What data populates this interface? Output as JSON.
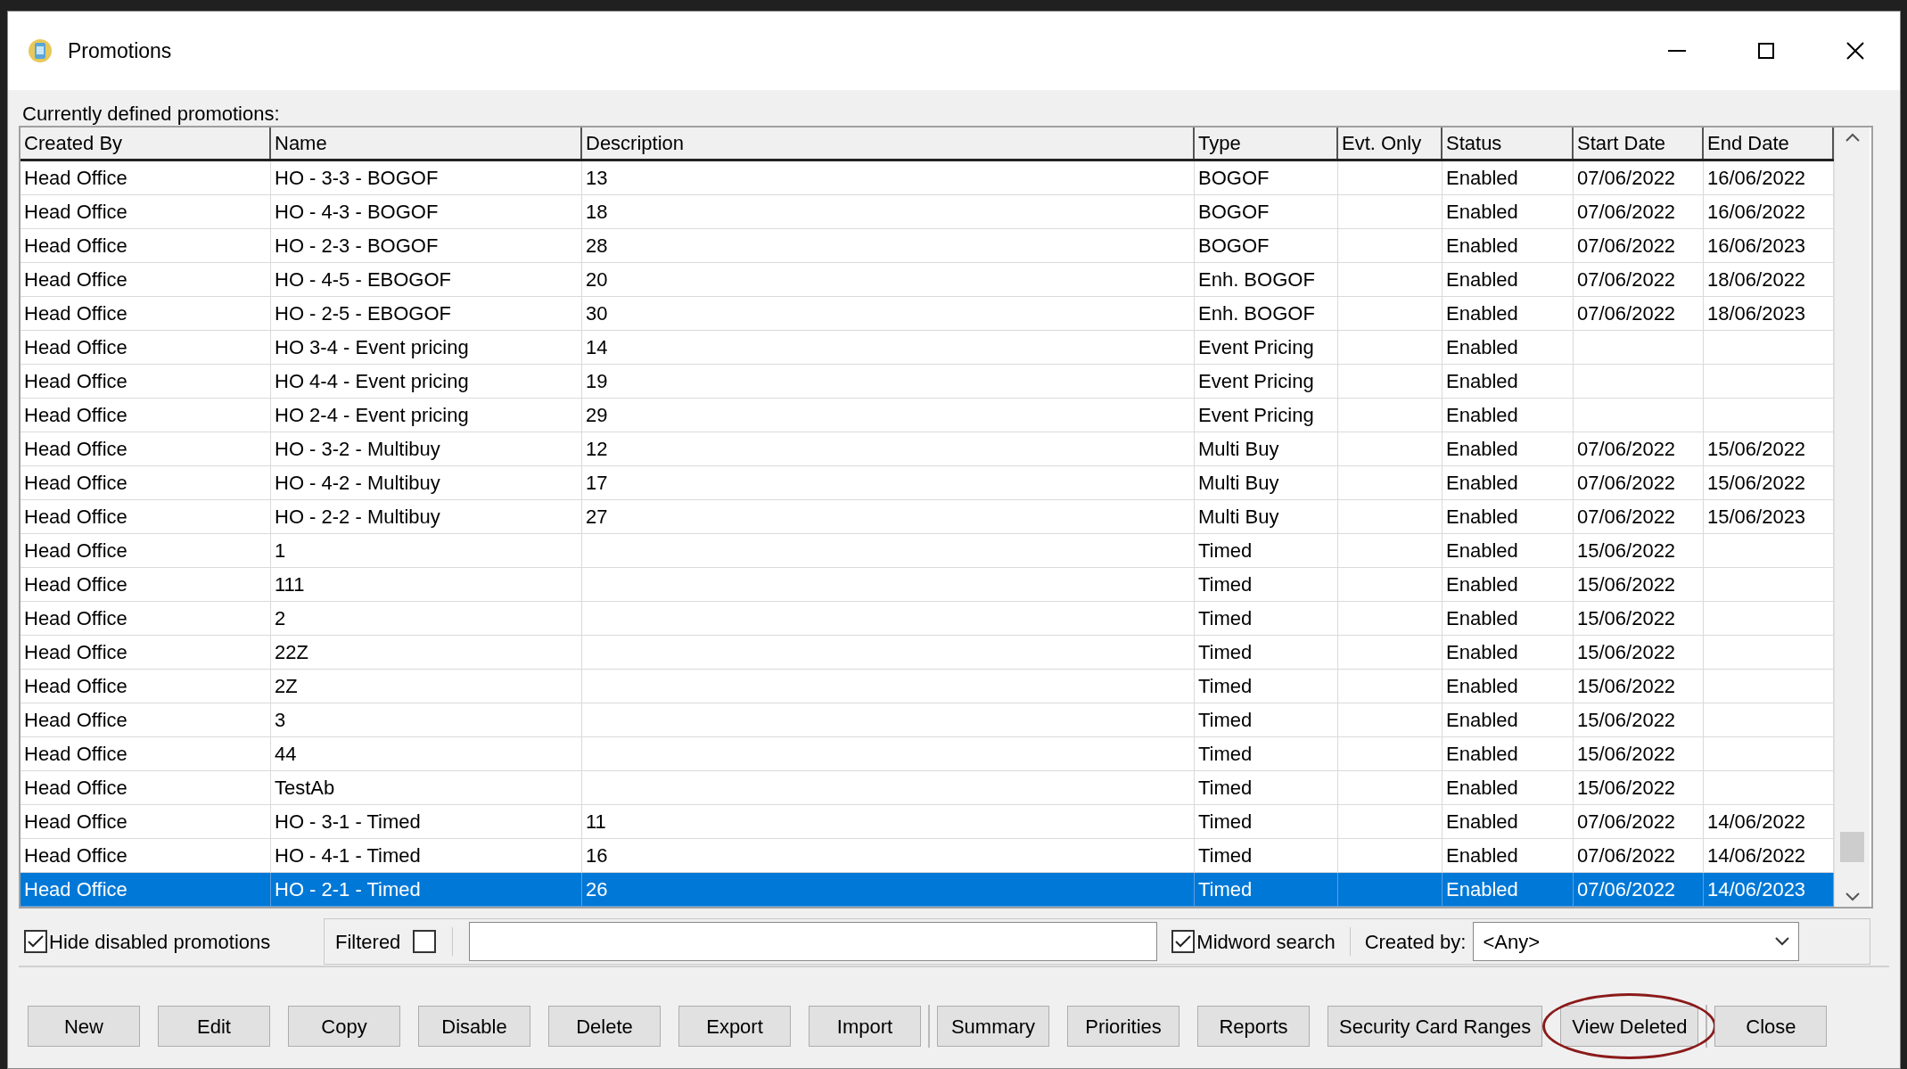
{
  "window": {
    "title": "Promotions"
  },
  "list_label": "Currently defined promotions:",
  "table": {
    "columns": [
      "Created By",
      "Name",
      "Description",
      "Type",
      "Evt. Only",
      "Status",
      "Start Date",
      "End Date"
    ],
    "rows": [
      {
        "selected": false,
        "cells": [
          "Head Office",
          "HO - 3-3 - BOGOF",
          "13",
          "BOGOF",
          null,
          "Enabled",
          "07/06/2022",
          "16/06/2022"
        ]
      },
      {
        "selected": false,
        "cells": [
          "Head Office",
          "HO - 4-3 - BOGOF",
          "18",
          "BOGOF",
          null,
          "Enabled",
          "07/06/2022",
          "16/06/2022"
        ]
      },
      {
        "selected": false,
        "cells": [
          "Head Office",
          "HO - 2-3 - BOGOF",
          "28",
          "BOGOF",
          null,
          "Enabled",
          "07/06/2022",
          "16/06/2023"
        ]
      },
      {
        "selected": false,
        "cells": [
          "Head Office",
          "HO - 4-5 - EBOGOF",
          "20",
          "Enh. BOGOF",
          null,
          "Enabled",
          "07/06/2022",
          "18/06/2022"
        ]
      },
      {
        "selected": false,
        "cells": [
          "Head Office",
          "HO - 2-5 - EBOGOF",
          "30",
          "Enh. BOGOF",
          null,
          "Enabled",
          "07/06/2022",
          "18/06/2023"
        ]
      },
      {
        "selected": false,
        "cells": [
          "Head Office",
          "HO 3-4 - Event pricing",
          "14",
          "Event Pricing",
          null,
          "Enabled",
          null,
          null
        ]
      },
      {
        "selected": false,
        "cells": [
          "Head Office",
          "HO 4-4 - Event pricing",
          "19",
          "Event Pricing",
          null,
          "Enabled",
          null,
          null
        ]
      },
      {
        "selected": false,
        "cells": [
          "Head Office",
          "HO 2-4 - Event pricing",
          "29",
          "Event Pricing",
          null,
          "Enabled",
          null,
          null
        ]
      },
      {
        "selected": false,
        "cells": [
          "Head Office",
          "HO - 3-2 - Multibuy",
          "12",
          "Multi Buy",
          null,
          "Enabled",
          "07/06/2022",
          "15/06/2022"
        ]
      },
      {
        "selected": false,
        "cells": [
          "Head Office",
          "HO - 4-2 - Multibuy",
          "17",
          "Multi Buy",
          null,
          "Enabled",
          "07/06/2022",
          "15/06/2022"
        ]
      },
      {
        "selected": false,
        "cells": [
          "Head Office",
          "HO - 2-2 - Multibuy",
          "27",
          "Multi Buy",
          null,
          "Enabled",
          "07/06/2022",
          "15/06/2023"
        ]
      },
      {
        "selected": false,
        "cells": [
          "Head Office",
          "1",
          null,
          "Timed",
          null,
          "Enabled",
          "15/06/2022",
          null
        ]
      },
      {
        "selected": false,
        "cells": [
          "Head Office",
          "111",
          null,
          "Timed",
          null,
          "Enabled",
          "15/06/2022",
          null
        ]
      },
      {
        "selected": false,
        "cells": [
          "Head Office",
          "2",
          null,
          "Timed",
          null,
          "Enabled",
          "15/06/2022",
          null
        ]
      },
      {
        "selected": false,
        "cells": [
          "Head Office",
          "22Z",
          null,
          "Timed",
          null,
          "Enabled",
          "15/06/2022",
          null
        ]
      },
      {
        "selected": false,
        "cells": [
          "Head Office",
          "2Z",
          null,
          "Timed",
          null,
          "Enabled",
          "15/06/2022",
          null
        ]
      },
      {
        "selected": false,
        "cells": [
          "Head Office",
          "3",
          null,
          "Timed",
          null,
          "Enabled",
          "15/06/2022",
          null
        ]
      },
      {
        "selected": false,
        "cells": [
          "Head Office",
          "44",
          null,
          "Timed",
          null,
          "Enabled",
          "15/06/2022",
          null
        ]
      },
      {
        "selected": false,
        "cells": [
          "Head Office",
          "TestAb",
          null,
          "Timed",
          null,
          "Enabled",
          "15/06/2022",
          null
        ]
      },
      {
        "selected": false,
        "cells": [
          "Head Office",
          "HO - 3-1 - Timed",
          "11",
          "Timed",
          null,
          "Enabled",
          "07/06/2022",
          "14/06/2022"
        ]
      },
      {
        "selected": false,
        "cells": [
          "Head Office",
          "HO - 4-1 - Timed",
          "16",
          "Timed",
          null,
          "Enabled",
          "07/06/2022",
          "14/06/2022"
        ]
      },
      {
        "selected": true,
        "cells": [
          "Head Office",
          "HO - 2-1 - Timed",
          "26",
          "Timed",
          null,
          "Enabled",
          "07/06/2022",
          "14/06/2023"
        ]
      }
    ]
  },
  "hide_disabled": {
    "label": "Hide disabled promotions",
    "checked": true
  },
  "filtered": {
    "label": "Filtered",
    "checked": false
  },
  "midword_search": {
    "label": "Midword search",
    "checked": true
  },
  "created_by": {
    "label": "Created by:",
    "value": "<Any>"
  },
  "button_groups": [
    [
      {
        "label": "New"
      },
      {
        "label": "Edit"
      },
      {
        "label": "Copy"
      },
      {
        "label": "Disable"
      },
      {
        "label": "Delete"
      },
      {
        "label": "Export"
      },
      {
        "label": "Import"
      }
    ],
    [
      {
        "label": "Summary"
      },
      {
        "label": "Priorities"
      },
      {
        "label": "Reports"
      },
      {
        "label": "Security Card Ranges"
      },
      {
        "label": "View Deleted",
        "circled": true
      }
    ],
    [
      {
        "label": "Close"
      }
    ]
  ]
}
